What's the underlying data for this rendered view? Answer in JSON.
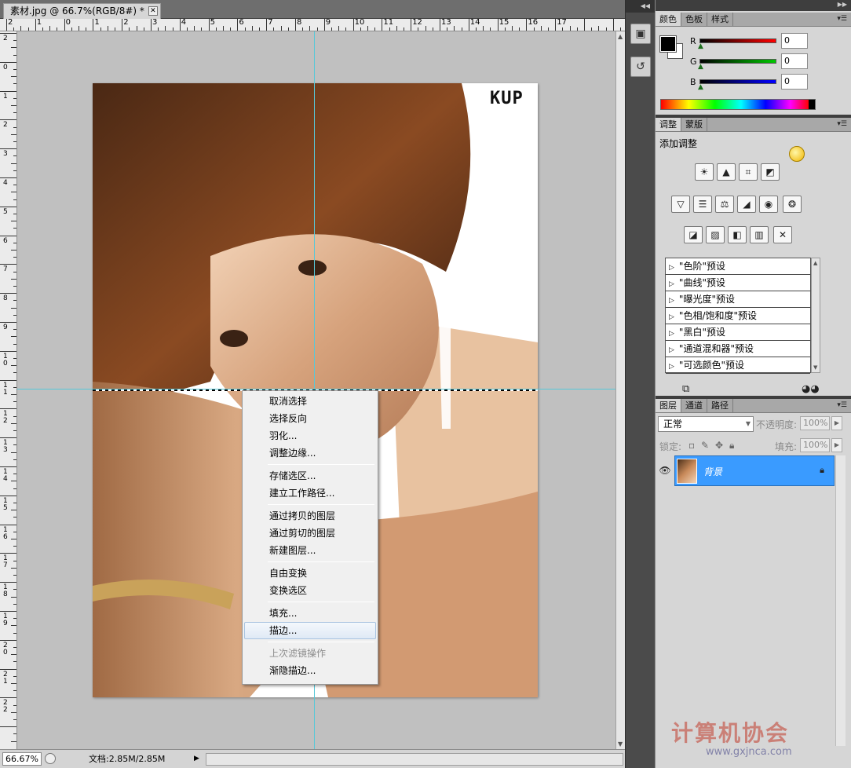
{
  "document": {
    "tab_title": "素材.jpg @ 66.7%(RGB/8#) *",
    "close_glyph": "✕",
    "logo_text": "KUP",
    "zoom": "66.67%",
    "doc_size": "文档:2.85M/2.85M",
    "ruler_h_labels": [
      "2",
      "1",
      "0",
      "1",
      "2",
      "3",
      "4",
      "5",
      "6",
      "7",
      "8",
      "9",
      "10",
      "11",
      "12",
      "13",
      "14",
      "15",
      "16",
      "17"
    ],
    "ruler_v_labels": [
      "2",
      "0",
      "1",
      "2",
      "3",
      "4",
      "5",
      "6",
      "7",
      "8",
      "9",
      "1\n0",
      "1\n1",
      "1\n2",
      "1\n3",
      "1\n4",
      "1\n5",
      "1\n6",
      "1\n7",
      "1\n8",
      "1\n9",
      "2\n0",
      "2\n1",
      "2\n2"
    ]
  },
  "context_menu": {
    "items": [
      {
        "label": "取消选择",
        "state": "normal"
      },
      {
        "label": "选择反向",
        "state": "normal"
      },
      {
        "label": "羽化...",
        "state": "normal"
      },
      {
        "label": "调整边缘...",
        "state": "normal"
      },
      {
        "label": "存储选区...",
        "state": "normal"
      },
      {
        "label": "建立工作路径...",
        "state": "normal"
      },
      {
        "label": "通过拷贝的图层",
        "state": "normal"
      },
      {
        "label": "通过剪切的图层",
        "state": "normal"
      },
      {
        "label": "新建图层...",
        "state": "normal"
      },
      {
        "label": "自由变换",
        "state": "normal"
      },
      {
        "label": "变换选区",
        "state": "normal"
      },
      {
        "label": "填充...",
        "state": "normal"
      },
      {
        "label": "描边...",
        "state": "hover"
      },
      {
        "label": "上次滤镜操作",
        "state": "disabled"
      },
      {
        "label": "渐隐描边...",
        "state": "normal"
      }
    ]
  },
  "color_panel": {
    "tabs": [
      "颜色",
      "色板",
      "样式"
    ],
    "channels": [
      {
        "label": "R",
        "value": "0",
        "gradient": "#ff0000"
      },
      {
        "label": "G",
        "value": "0",
        "gradient": "#00c800"
      },
      {
        "label": "B",
        "value": "0",
        "gradient": "#0000ff"
      }
    ]
  },
  "adjustments_panel": {
    "tabs": [
      "调整",
      "蒙版"
    ],
    "title": "添加调整",
    "presets": [
      "\"色阶\"预设",
      "\"曲线\"预设",
      "\"曝光度\"预设",
      "\"色相/饱和度\"预设",
      "\"黑白\"预设",
      "\"通道混和器\"预设",
      "\"可选颜色\"预设"
    ]
  },
  "layers_panel": {
    "tabs": [
      "图层",
      "通道",
      "路径"
    ],
    "blend_mode": "正常",
    "opacity_label": "不透明度:",
    "opacity_value": "100%",
    "lock_label": "锁定:",
    "fill_label": "填充:",
    "fill_value": "100%",
    "layer_name": "背景"
  },
  "watermark": {
    "text": "计算机协会",
    "url": "www.gxjnca.com"
  },
  "colors": {
    "accent_selection": "#3a9bff",
    "guide": "#58c8d8",
    "canvas_bg": "#c0c0c0"
  }
}
